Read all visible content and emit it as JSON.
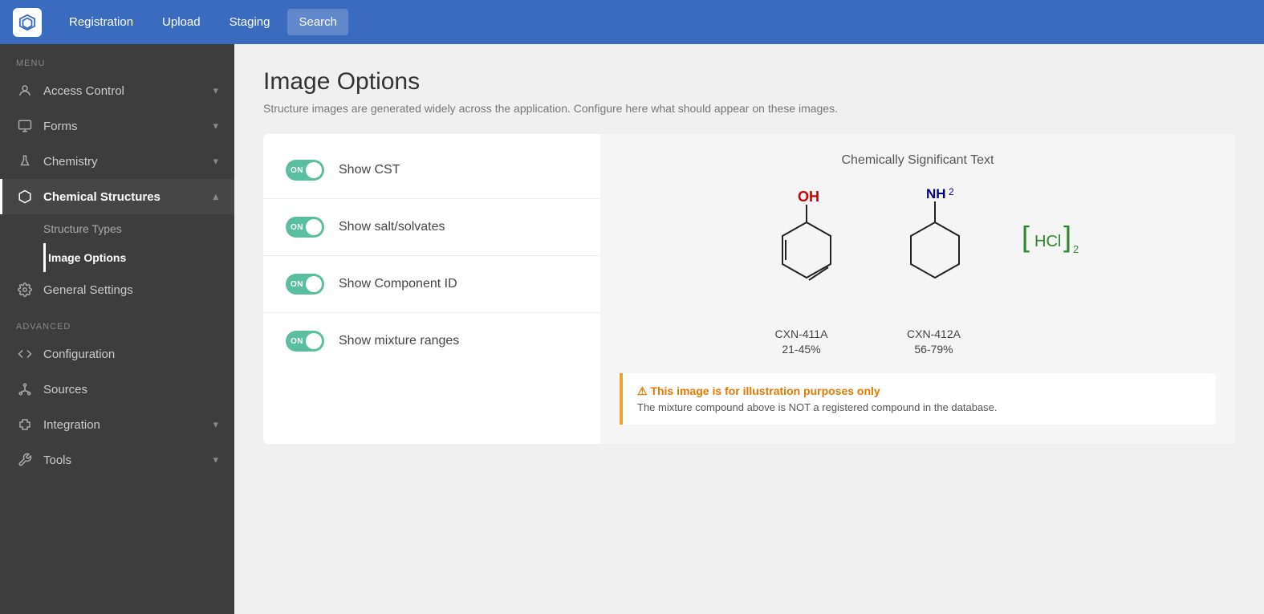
{
  "nav": {
    "links": [
      {
        "label": "Registration",
        "active": false
      },
      {
        "label": "Upload",
        "active": false
      },
      {
        "label": "Staging",
        "active": false
      },
      {
        "label": "Search",
        "active": true
      }
    ]
  },
  "sidebar": {
    "menu_label": "MENU",
    "advanced_label": "ADVANCED",
    "items": [
      {
        "id": "access-control",
        "label": "Access Control",
        "icon": "person",
        "has_chevron": true,
        "active": false
      },
      {
        "id": "forms",
        "label": "Forms",
        "icon": "monitor",
        "has_chevron": true,
        "active": false
      },
      {
        "id": "chemistry",
        "label": "Chemistry",
        "icon": "flask",
        "has_chevron": true,
        "active": false
      },
      {
        "id": "chemical-structures",
        "label": "Chemical Structures",
        "icon": "hexagon",
        "has_chevron": true,
        "active": true
      }
    ],
    "sub_items": [
      {
        "id": "structure-types",
        "label": "Structure Types",
        "active": false
      },
      {
        "id": "image-options",
        "label": "Image Options",
        "active": true
      }
    ],
    "advanced_items": [
      {
        "id": "general-settings",
        "label": "General Settings",
        "icon": "gear",
        "active": false
      },
      {
        "id": "configuration",
        "label": "Configuration",
        "icon": "code",
        "has_chevron": false,
        "active": false
      },
      {
        "id": "sources",
        "label": "Sources",
        "icon": "hub",
        "active": false
      },
      {
        "id": "integration",
        "label": "Integration",
        "icon": "puzzle",
        "has_chevron": true,
        "active": false
      },
      {
        "id": "tools",
        "label": "Tools",
        "icon": "wrench",
        "has_chevron": true,
        "active": false
      }
    ]
  },
  "page": {
    "title": "Image Options",
    "subtitle": "Structure images are generated widely across the application. Configure here what should appear on these images."
  },
  "options": [
    {
      "id": "show-cst",
      "label": "Show CST",
      "on": true
    },
    {
      "id": "show-salt-solvates",
      "label": "Show salt/solvates",
      "on": true
    },
    {
      "id": "show-component-id",
      "label": "Show Component ID",
      "on": true
    },
    {
      "id": "show-mixture-ranges",
      "label": "Show mixture ranges",
      "on": true
    }
  ],
  "preview": {
    "title": "Chemically Significant Text",
    "molecules": [
      {
        "id": "CXN-411A",
        "range": "21-45%"
      },
      {
        "id": "CXN-412A",
        "range": "56-79%"
      },
      {
        "id": "HCl",
        "range": ""
      }
    ],
    "warning_title": "⚠ This image is for illustration purposes only",
    "warning_text": "The mixture compound above is NOT a registered compound in the database."
  },
  "toggle_label": "ON"
}
